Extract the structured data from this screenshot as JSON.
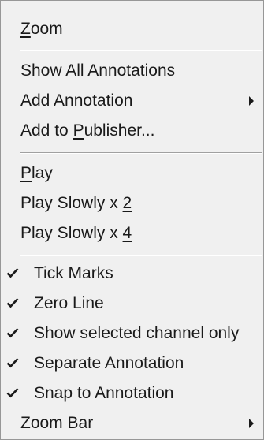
{
  "menu": {
    "zoom": {
      "mnemonic": "Z",
      "rest": "oom"
    },
    "show_all_annotations": "Show All Annotations",
    "add_annotation": "Add Annotation",
    "add_to_publisher": {
      "pre": "Add to ",
      "mnemonic": "P",
      "rest": "ublisher..."
    },
    "play": {
      "mnemonic": "P",
      "rest": "lay"
    },
    "play_slowly_2": {
      "pre": "Play Slowly x ",
      "mnemonic": "2"
    },
    "play_slowly_4": {
      "pre": "Play Slowly x ",
      "mnemonic": "4"
    },
    "tick_marks": "Tick Marks",
    "zero_line": "Zero Line",
    "show_selected_channel_only": "Show selected channel only",
    "separate_annotation": "Separate Annotation",
    "snap_to_annotation": "Snap to Annotation",
    "zoom_bar": "Zoom Bar"
  },
  "checked_items": [
    "tick_marks",
    "zero_line",
    "show_selected_channel_only",
    "separate_annotation",
    "snap_to_annotation"
  ],
  "submenu_items": [
    "add_annotation",
    "zoom_bar"
  ],
  "icons": {
    "check": "checkmark-icon",
    "submenu": "submenu-arrow-icon"
  }
}
